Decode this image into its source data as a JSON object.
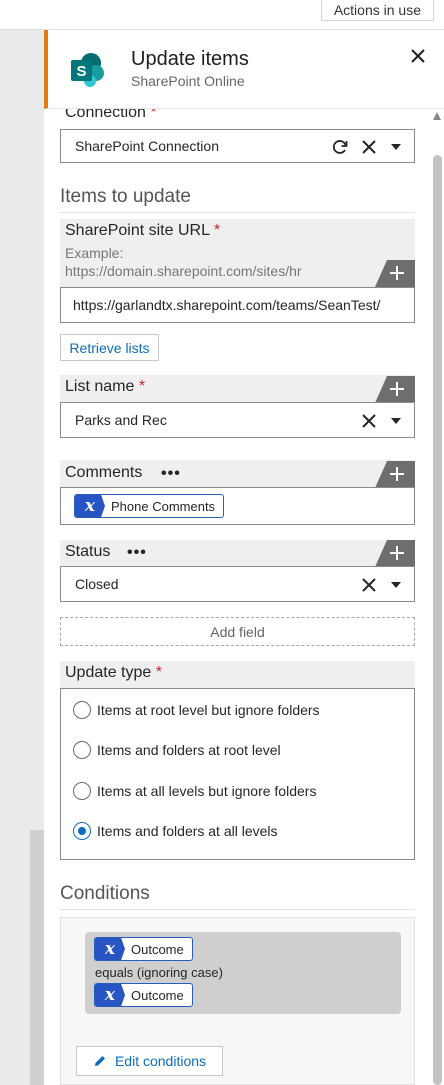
{
  "topbar": {
    "actions_label": "Actions in use"
  },
  "header": {
    "title": "Update items",
    "subtitle": "SharePoint Online",
    "logo_letter": "S",
    "accent_color": "#e07b14"
  },
  "connection": {
    "label": "Connection",
    "required": "*",
    "value": "SharePoint Connection"
  },
  "items_section": {
    "title": "Items to update"
  },
  "site_url": {
    "label": "SharePoint site URL",
    "required": "*",
    "hint_line1": "Example:",
    "hint_line2": "https://domain.sharepoint.com/sites/hr",
    "value": "https://garlandtx.sharepoint.com/teams/SeanTest/"
  },
  "retrieve_lists_label": "Retrieve lists",
  "list_name": {
    "label": "List name",
    "required": "*",
    "value": "Parks and Rec"
  },
  "comments": {
    "label": "Comments",
    "dots": "•••",
    "token_label": "Phone Comments",
    "token_icon": "x"
  },
  "status": {
    "label": "Status",
    "dots": "•••",
    "value": "Closed"
  },
  "add_field_label": "Add field",
  "update_type": {
    "label": "Update type",
    "required": "*",
    "options": [
      {
        "label": "Items at root level but ignore folders",
        "checked": false
      },
      {
        "label": "Items and folders at root level",
        "checked": false
      },
      {
        "label": "Items at all levels but ignore folders",
        "checked": false
      },
      {
        "label": "Items and folders at all levels",
        "checked": true
      }
    ]
  },
  "conditions": {
    "title": "Conditions",
    "left_token": "Outcome",
    "operator": "equals (ignoring case)",
    "right_token": "Outcome",
    "edit_label": "Edit conditions"
  },
  "colors": {
    "accent_blue": "#0f6cbd",
    "token_blue": "#2756c4",
    "required_red": "#c4262e"
  }
}
